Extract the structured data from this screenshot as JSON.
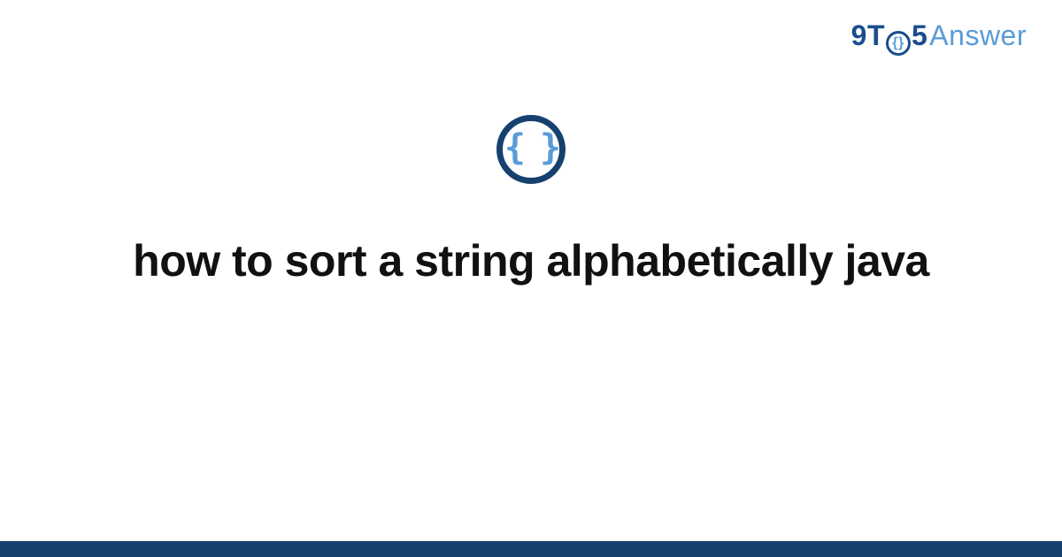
{
  "logo": {
    "part1": "9T",
    "circle_glyph": "{}",
    "part2": "5",
    "word": "Answer"
  },
  "badge": {
    "glyph": "{ }"
  },
  "title": "how to sort a string alphabetically java"
}
